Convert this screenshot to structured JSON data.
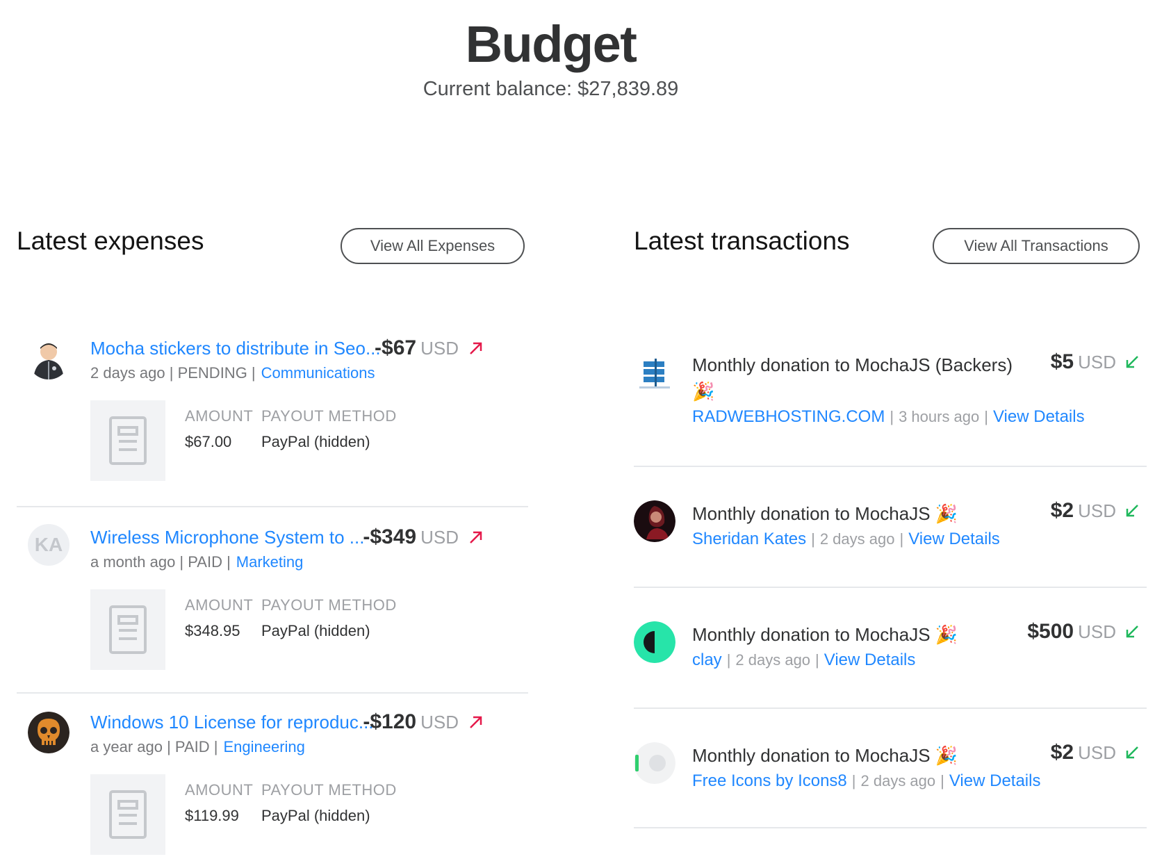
{
  "header": {
    "title": "Budget",
    "balance": "Current balance: $27,839.89"
  },
  "expenses_section": {
    "title": "Latest expenses",
    "view_all_label": "View All Expenses",
    "amount_label": "AMOUNT",
    "payout_label": "PAYOUT METHOD",
    "items": [
      {
        "title": "Mocha stickers to distribute in Seo...",
        "amount": "-$67",
        "currency": "USD",
        "meta": "2 days ago | PENDING |",
        "tag": "Communications",
        "amount_value": "$67.00",
        "payout": "PayPal (hidden)",
        "avatar": "person-avatar"
      },
      {
        "title": "Wireless Microphone System to ...",
        "amount": "-$349",
        "currency": "USD",
        "meta": "a month ago | PAID |",
        "tag": "Marketing",
        "amount_value": "$348.95",
        "payout": "PayPal (hidden)",
        "avatar": "KA"
      },
      {
        "title": "Windows 10 License for reproduc...",
        "amount": "-$120",
        "currency": "USD",
        "meta": "a year ago | PAID |",
        "tag": "Engineering",
        "amount_value": "$119.99",
        "payout": "PayPal (hidden)",
        "avatar": "skull-avatar"
      }
    ]
  },
  "transactions_section": {
    "title": "Latest transactions",
    "view_all_label": "View All Transactions",
    "items": [
      {
        "desc": "Monthly donation to MochaJS (Backers) 🎉",
        "amount": "$5",
        "currency": "USD",
        "party": "RADWEBHOSTING.COM",
        "time": "3 hours ago",
        "details": "View Details"
      },
      {
        "desc": "Monthly donation to MochaJS 🎉",
        "amount": "$2",
        "currency": "USD",
        "party": "Sheridan Kates",
        "time": "2 days ago",
        "details": "View Details"
      },
      {
        "desc": "Monthly donation to MochaJS 🎉",
        "amount": "$500",
        "currency": "USD",
        "party": "clay",
        "time": "2 days ago",
        "details": "View Details"
      },
      {
        "desc": "Monthly donation to MochaJS 🎉",
        "amount": "$2",
        "currency": "USD",
        "party": "Free Icons by Icons8",
        "time": "2 days ago",
        "details": "View Details"
      }
    ]
  },
  "colors": {
    "link": "#1f87ff",
    "expense_arrow": "#e5194a",
    "income_arrow": "#1fb85c"
  }
}
